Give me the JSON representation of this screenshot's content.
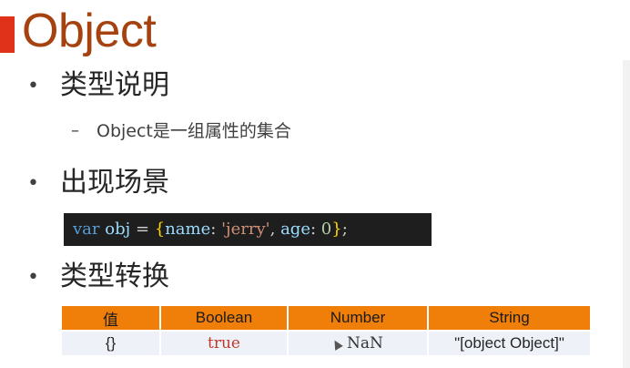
{
  "slide": {
    "title": "Object",
    "sections": [
      {
        "heading": "类型说明",
        "sub": "Object是一组属性的集合"
      },
      {
        "heading": "出现场景"
      },
      {
        "heading": "类型转换"
      }
    ],
    "bullet_glyph": "•",
    "dash_glyph": "–"
  },
  "code": {
    "kw": "var",
    "name": "obj",
    "eq": "=",
    "open": "{",
    "key1": "name",
    "colon1": ":",
    "str1": "'jerry'",
    "comma": ",",
    "key2": "age",
    "colon2": ":",
    "num": "0",
    "close": "}",
    "semi": ";"
  },
  "table": {
    "headers": [
      "值",
      "Boolean",
      "Number",
      "String"
    ],
    "rows": [
      [
        "{}",
        "true",
        "NaN",
        "\"[object Object]\""
      ]
    ]
  },
  "colors": {
    "title": "#a5420f",
    "accent_bar": "#e0321b",
    "table_header": "#f07f09",
    "table_row": "#eef2f8",
    "code_bg": "#1e1e1e"
  }
}
